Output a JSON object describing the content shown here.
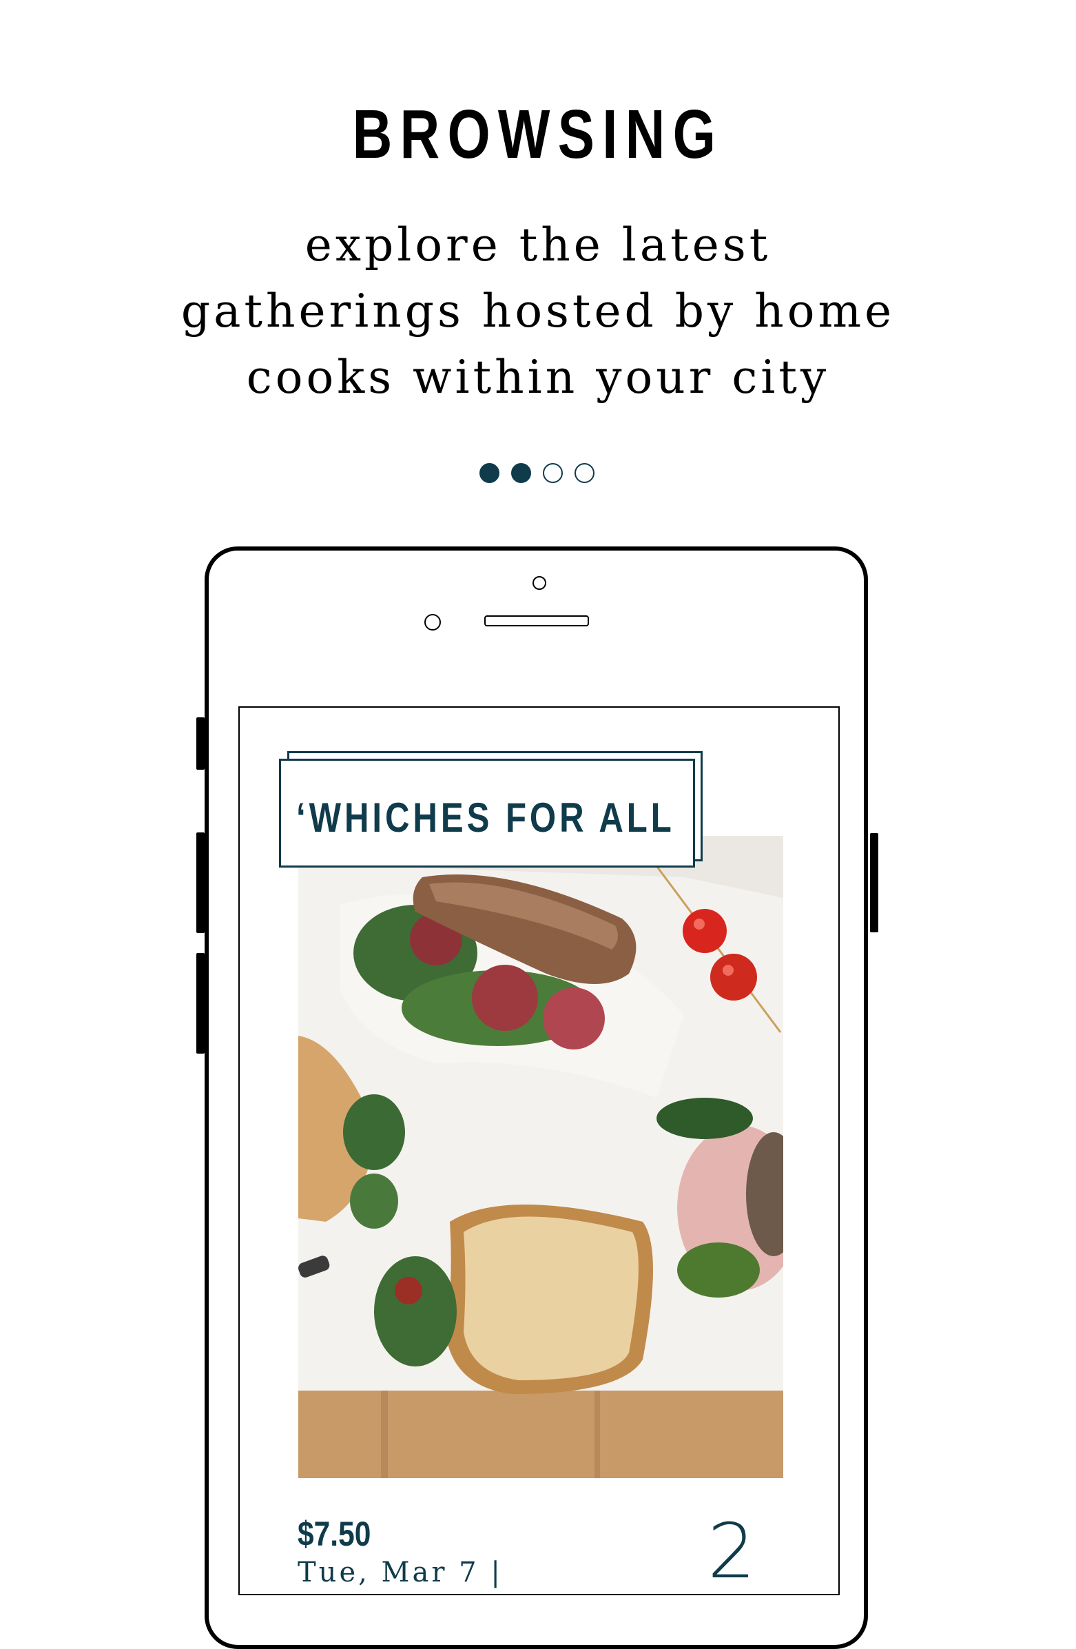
{
  "header": {
    "title": "BROWSING",
    "subtitle": "explore the latest gatherings hosted by home cooks within your city"
  },
  "pager": {
    "total": 4,
    "filled": 2
  },
  "card": {
    "title": "‘WHICHES FOR ALL",
    "price": "$7.50",
    "date_partial": "Tue, Mar 7 |",
    "count": "2",
    "image": "sandwich-photo"
  },
  "colors": {
    "accent": "#0f3b4b",
    "frame": "#000000",
    "background": "#ffffff"
  }
}
